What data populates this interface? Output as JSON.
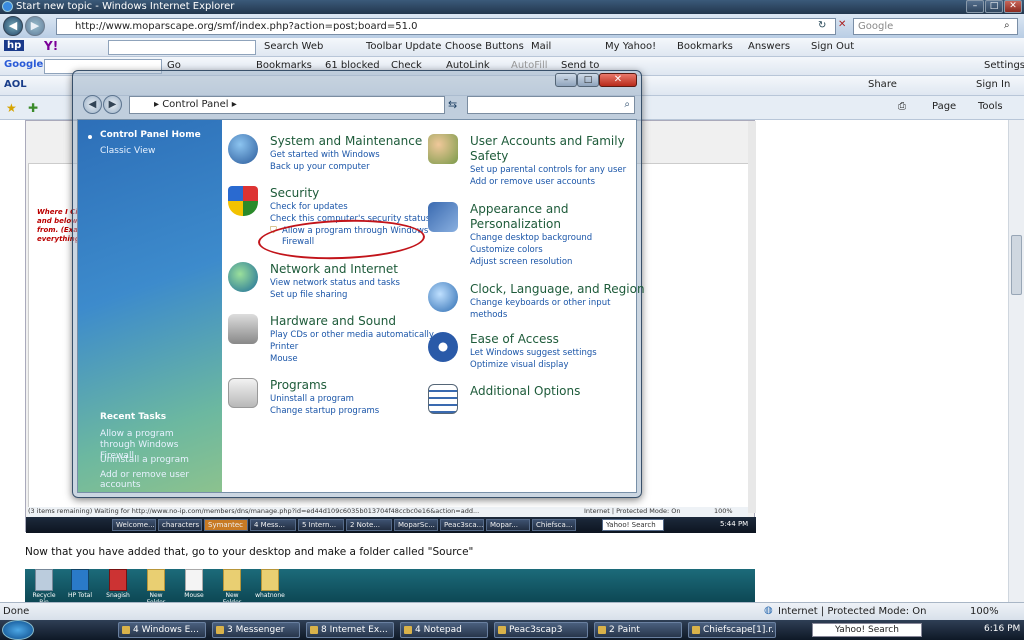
{
  "window": {
    "title": "Start new topic - Windows Internet Explorer"
  },
  "address": {
    "url": "http://www.moparscape.org/smf/index.php?action=post;board=51.0",
    "search_placeholder": "Google"
  },
  "toolbar1": {
    "search_web": "Search Web",
    "toolbar_update": "Toolbar Update",
    "choose_buttons": "Choose Buttons",
    "mail": "Mail",
    "my_yahoo": "My Yahoo!",
    "bookmarks": "Bookmarks",
    "answers": "Answers",
    "sign_out": "Sign Out"
  },
  "toolbar2": {
    "go": "Go",
    "bookmarks": "Bookmarks",
    "blocked": "61 blocked",
    "check": "Check",
    "autolink": "AutoLink",
    "autofill": "AutoFill",
    "send_to": "Send to",
    "settings": "Settings"
  },
  "toolbar3": {
    "aol": "AOL",
    "share": "Share",
    "sign_in": "Sign In",
    "page": "Page",
    "tools": "Tools"
  },
  "control_panel": {
    "breadcrumb": "Control Panel",
    "sidebar": {
      "home": "Control Panel Home",
      "classic": "Classic View",
      "recent_title": "Recent Tasks",
      "recent": [
        "Allow a program through Windows Firewall",
        "Uninstall a program",
        "Add or remove user accounts"
      ]
    },
    "left": [
      {
        "title": "System and Maintenance",
        "links": [
          "Get started with Windows",
          "Back up your computer"
        ]
      },
      {
        "title": "Security",
        "links": [
          "Check for updates",
          "Check this computer's security status",
          "Allow a program through Windows",
          "Firewall"
        ]
      },
      {
        "title": "Network and Internet",
        "links": [
          "View network status and tasks",
          "Set up file sharing"
        ]
      },
      {
        "title": "Hardware and Sound",
        "links": [
          "Play CDs or other media automatically",
          "Printer",
          "Mouse"
        ]
      },
      {
        "title": "Programs",
        "links": [
          "Uninstall a program",
          "Change startup programs"
        ]
      }
    ],
    "right": [
      {
        "title": "User Accounts and Family",
        "title2": "Safety",
        "links": [
          "Set up parental controls for any user",
          "Add or remove user accounts"
        ]
      },
      {
        "title": "Appearance and",
        "title2": "Personalization",
        "links": [
          "Change desktop background",
          "Customize colors",
          "Adjust screen resolution"
        ]
      },
      {
        "title": "Clock, Language, and Region",
        "links": [
          "Change keyboards or other input",
          "methods"
        ]
      },
      {
        "title": "Ease of Access",
        "links": [
          "Let Windows suggest settings",
          "Optimize visual display"
        ]
      },
      {
        "title": "Additional Options",
        "links": []
      }
    ]
  },
  "inner": {
    "status": "(3 items remaining) Waiting for http://www.no-ip.com/members/dns/manage.php?id=ed44d109c6035b013704f48ccbc0e16&action=add...",
    "zone": "Internet | Protected Mode: On",
    "zoom": "100%",
    "left_text": [
      "Where I Ci",
      "and below",
      "from. (Exa",
      "everything"
    ],
    "tasks": [
      "Welcome...",
      "characters",
      "Symantec",
      "4 Mess...",
      "5 Intern...",
      "2 Note...",
      "MoparSc...",
      "Peac3sca...",
      "Mopar...",
      "Chiefsca...",
      "Yahoo! Search"
    ],
    "time": "5:44 PM",
    "desktop": [
      "Recycle Bin",
      "HP Total",
      "Snagish",
      "New Folder",
      "Mouse",
      "New Folder",
      "whatnone"
    ]
  },
  "caption": "Now that you have added that, go to your desktop and make a folder called \"Source\"",
  "status": {
    "text": "Done",
    "zone": "Internet | Protected Mode: On",
    "zoom": "100%"
  },
  "taskbar": {
    "items": [
      "4 Windows E...",
      "3 Messenger",
      "8 Internet Ex...",
      "4 Notepad",
      "Peac3scap3",
      "2 Paint",
      "Chiefscape[1].r..."
    ],
    "search": "Yahoo! Search",
    "time": "6:16 PM"
  }
}
